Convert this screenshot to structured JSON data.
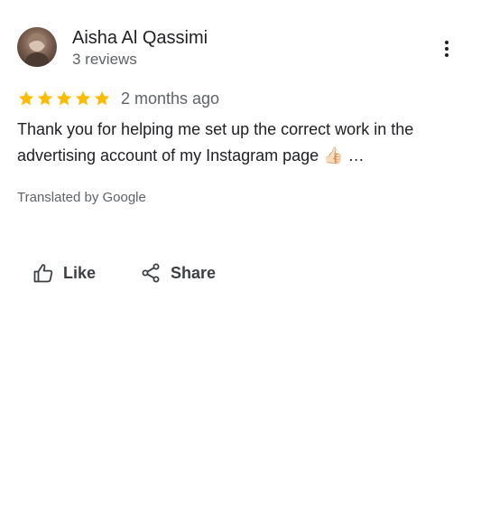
{
  "review": {
    "author": {
      "name": "Aisha Al Qassimi",
      "review_count": "3 reviews"
    },
    "rating": 5,
    "date": "2 months ago",
    "text": "Thank you for helping me set up the correct work in the advertising account of my Instagram page 👍🏻",
    "truncation": "…",
    "translated_note": "Translated by Google"
  },
  "actions": {
    "like_label": "Like",
    "share_label": "Share"
  },
  "colors": {
    "star": "#fbbc04",
    "text_primary": "#202124",
    "text_secondary": "#5f6368"
  },
  "icons": {
    "more": "more-vert-icon",
    "like": "thumb-up-icon",
    "share": "share-icon",
    "star": "star-icon"
  }
}
